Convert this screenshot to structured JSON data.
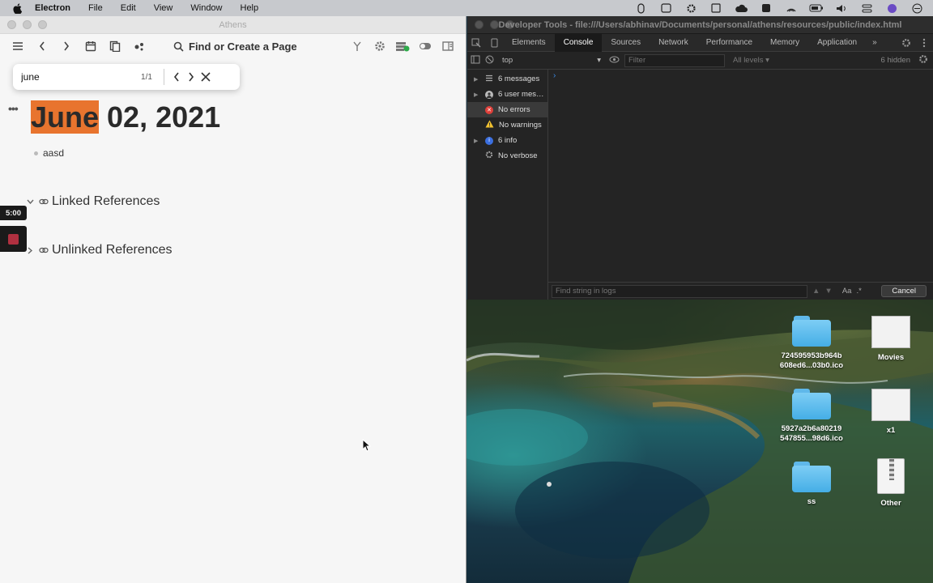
{
  "menubar": {
    "app_name": "Electron",
    "items": [
      "File",
      "Edit",
      "View",
      "Window",
      "Help"
    ]
  },
  "athens": {
    "window_title": "Athens",
    "search_label": "Find or Create a Page",
    "find": {
      "query": "june",
      "count": "1/1"
    },
    "page": {
      "title_highlight": "June",
      "title_rest": " 02, 2021",
      "block_text": "aasd",
      "linked_refs": "Linked References",
      "unlinked_refs": "Unlinked References"
    },
    "recorder": {
      "timer": "5:00"
    },
    "colors": {
      "highlight": "#e8742e"
    }
  },
  "devtools": {
    "title": "Developer Tools - file:///Users/abhinav/Documents/personal/athens/resources/public/index.html",
    "tabs": [
      "Elements",
      "Console",
      "Sources",
      "Network",
      "Performance",
      "Memory",
      "Application"
    ],
    "active_tab": "Console",
    "context": "top",
    "filter_placeholder": "Filter",
    "levels": "All levels",
    "hidden": "6 hidden",
    "sidebar": [
      {
        "label": "6 messages",
        "icon": "list-icon"
      },
      {
        "label": "6 user mes…",
        "icon": "user-icon"
      },
      {
        "label": "No errors",
        "icon": "error-icon"
      },
      {
        "label": "No warnings",
        "icon": "warning-icon"
      },
      {
        "label": "6 info",
        "icon": "info-icon"
      },
      {
        "label": "No verbose",
        "icon": "bug-icon"
      }
    ],
    "find_placeholder": "Find string in logs",
    "case_label": "Aa",
    "regex_label": ".*",
    "cancel_label": "Cancel"
  },
  "desktop": {
    "items": [
      {
        "label": "724595953b964b 608ed6...03b0.ico",
        "icon": "folder-icon"
      },
      {
        "label": "Movies",
        "icon": "document-thumbnail-icon"
      },
      {
        "label": "5927a2b6a80219 547855...98d6.ico",
        "icon": "folder-icon"
      },
      {
        "label": "x1",
        "icon": "image-thumbnail-icon"
      },
      {
        "label": "ss",
        "icon": "folder-icon"
      },
      {
        "label": "Other",
        "icon": "zip-icon"
      }
    ]
  }
}
